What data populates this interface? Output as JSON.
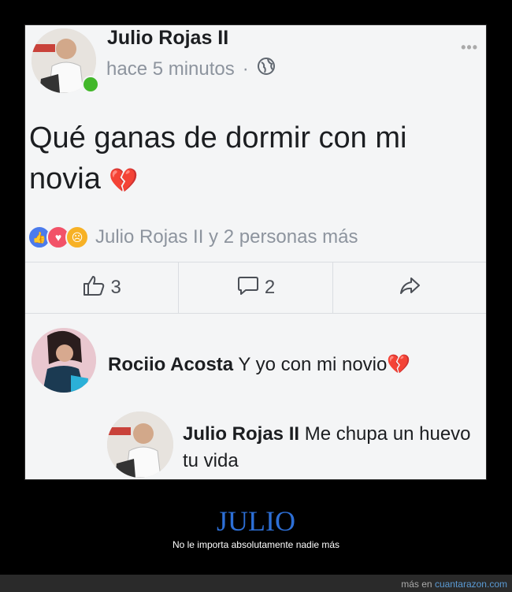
{
  "post": {
    "author": "Julio Rojas II",
    "time": "hace 5 minutos",
    "separator": "·",
    "text": "Qué ganas de dormir con mi novia",
    "text_emoji": "💔",
    "reactions_text": "Julio Rojas II y 2 personas más",
    "actions": {
      "likes": "3",
      "comments": "2"
    }
  },
  "comments": [
    {
      "author": "Rociio Acosta",
      "text": "Y yo con mi novio",
      "emoji": "💔"
    },
    {
      "author": "Julio Rojas II",
      "text": "Me chupa un huevo tu vida"
    }
  ],
  "footer": {
    "title": "JULIO",
    "subtitle": "No le importa absolutamente nadie más",
    "credit_prefix": "más en",
    "credit_site": "cuantarazon.com"
  },
  "colors": {
    "like": "#4b7bec",
    "love": "#f25268",
    "sad": "#f7b125",
    "brand": "#2d6fd6",
    "online": "#42b72a"
  },
  "icons": [
    "globe-icon",
    "like-icon",
    "comment-icon",
    "share-icon",
    "more-icon"
  ]
}
